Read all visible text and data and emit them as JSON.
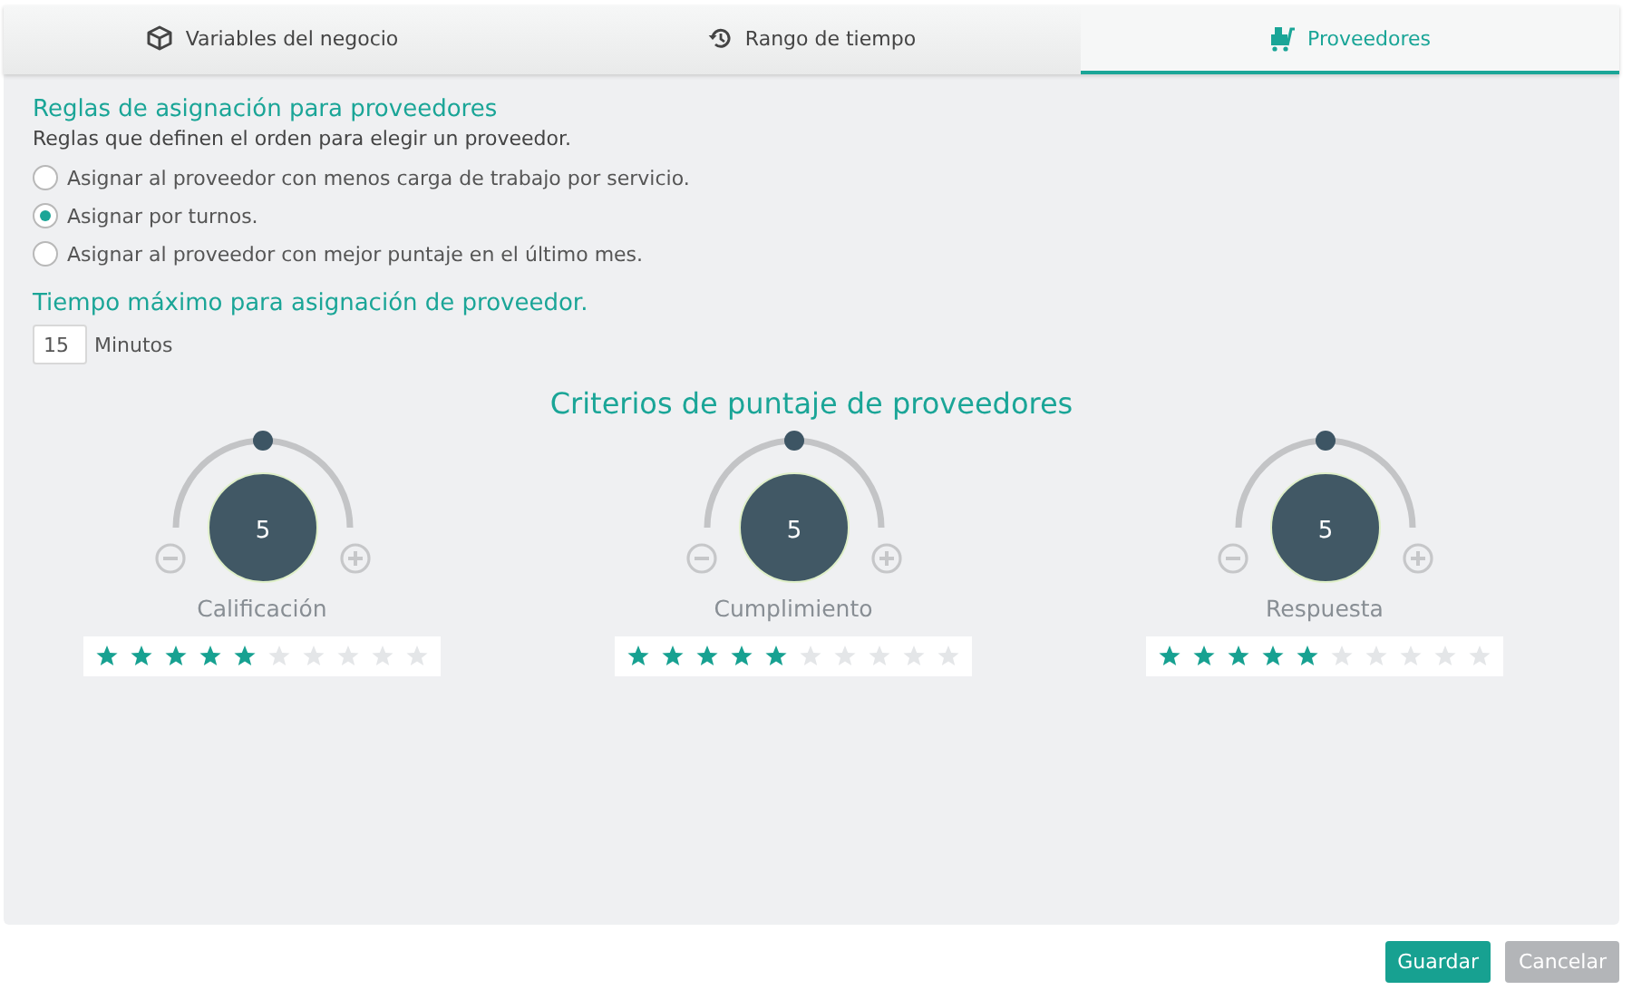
{
  "tabs": [
    {
      "label": "Variables del negocio",
      "selected": false
    },
    {
      "label": "Rango de tiempo",
      "selected": false
    },
    {
      "label": "Proveedores",
      "selected": true
    }
  ],
  "rules": {
    "title": "Reglas de asignación para proveedores",
    "subtitle": "Reglas que definen el orden para elegir un proveedor.",
    "options": [
      {
        "label": "Asignar al proveedor con menos carga de trabajo por servicio.",
        "selected": false
      },
      {
        "label": "Asignar por turnos.",
        "selected": true
      },
      {
        "label": "Asignar al proveedor con mejor puntaje en el último mes.",
        "selected": false
      }
    ]
  },
  "max_time": {
    "title": "Tiempo máximo para asignación de proveedor.",
    "value": "15",
    "unit": "Minutos"
  },
  "criteria_title": "Criterios de puntaje de proveedores",
  "criteria": [
    {
      "value": "5",
      "level": 0.5,
      "label": "Calificación",
      "stars": 5
    },
    {
      "value": "5",
      "level": 0.5,
      "label": "Cumplimiento",
      "stars": 5
    },
    {
      "value": "5",
      "level": 0.5,
      "label": "Respuesta",
      "stars": 5
    }
  ],
  "buttons": [
    {
      "label": "Guardar",
      "kind": "primary"
    },
    {
      "label": "Cancelar",
      "kind": "secondary"
    }
  ]
}
